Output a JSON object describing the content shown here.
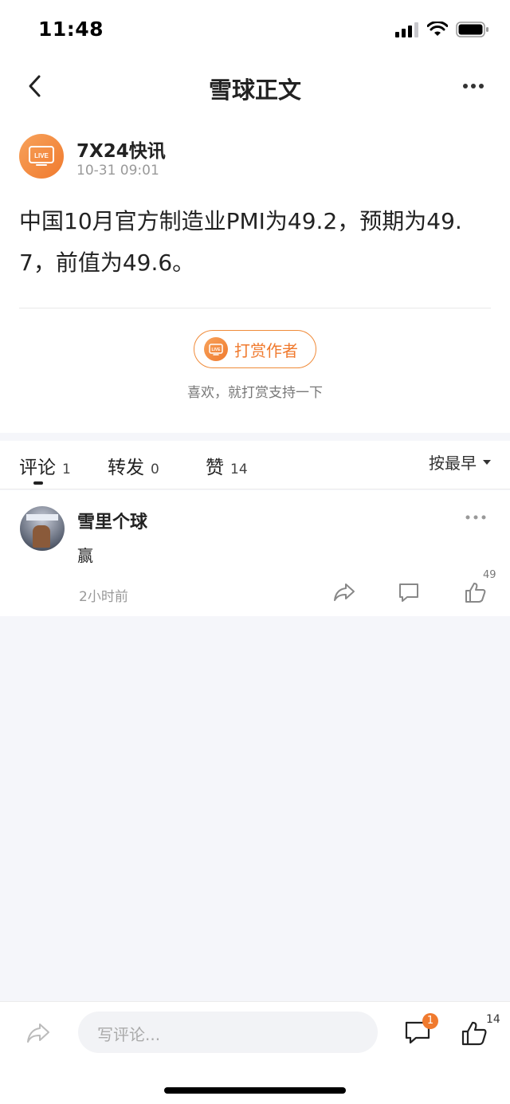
{
  "status_bar": {
    "time": "11:48"
  },
  "nav": {
    "title": "雪球正文"
  },
  "author": {
    "name": "7X24快讯",
    "time": "10-31 09:01",
    "avatar_label": "LIVE"
  },
  "post": {
    "text": "中国10月官方制造业PMI为49.2，预期为49.7，前值为49.6。"
  },
  "reward": {
    "button_label": "打赏作者",
    "subtitle": "喜欢，就打赏支持一下",
    "icon_label": "LIVE"
  },
  "tabs": [
    {
      "label": "评论",
      "count": "1"
    },
    {
      "label": "转发",
      "count": "0"
    },
    {
      "label": "赞",
      "count": "14"
    }
  ],
  "sort": {
    "label": "按最早"
  },
  "comments": [
    {
      "name": "雪里个球",
      "text": "赢",
      "time": "2小时前",
      "like_count": "49"
    }
  ],
  "bottom_bar": {
    "input_placeholder": "写评论...",
    "comment_badge": "1",
    "like_count": "14"
  },
  "colors": {
    "accent": "#f07a2e",
    "background": "#f5f6fa"
  }
}
